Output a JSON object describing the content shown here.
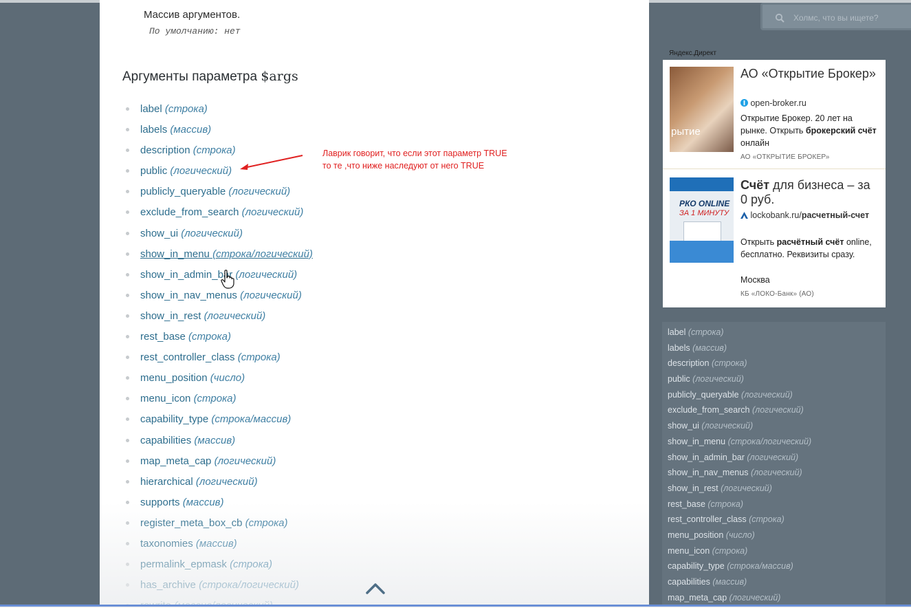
{
  "main": {
    "arg_description": "Массив аргументов.",
    "arg_default": "По умолчанию: нет",
    "section_title_prefix": "Аргументы параметра ",
    "section_title_code": "$args",
    "params": [
      {
        "name": "label",
        "type": "(строка)"
      },
      {
        "name": "labels",
        "type": "(массив)"
      },
      {
        "name": "description",
        "type": "(строка)"
      },
      {
        "name": "public",
        "type": "(логический)"
      },
      {
        "name": "publicly_queryable",
        "type": "(логический)"
      },
      {
        "name": "exclude_from_search",
        "type": "(логический)"
      },
      {
        "name": "show_ui",
        "type": "(логический)"
      },
      {
        "name": "show_in_menu",
        "type": "(строка/логический)"
      },
      {
        "name": "show_in_admin_bar",
        "type": "(логический)"
      },
      {
        "name": "show_in_nav_menus",
        "type": "(логический)"
      },
      {
        "name": "show_in_rest",
        "type": "(логический)"
      },
      {
        "name": "rest_base",
        "type": "(строка)"
      },
      {
        "name": "rest_controller_class",
        "type": "(строка)"
      },
      {
        "name": "menu_position",
        "type": "(число)"
      },
      {
        "name": "menu_icon",
        "type": "(строка)"
      },
      {
        "name": "capability_type",
        "type": "(строка/массив)"
      },
      {
        "name": "capabilities",
        "type": "(массив)"
      },
      {
        "name": "map_meta_cap",
        "type": "(логический)"
      },
      {
        "name": "hierarchical",
        "type": "(логический)"
      },
      {
        "name": "supports",
        "type": "(массив)"
      },
      {
        "name": "register_meta_box_cb",
        "type": "(строка)"
      },
      {
        "name": "taxonomies",
        "type": "(массив)"
      },
      {
        "name": "permalink_epmask",
        "type": "(строка)"
      },
      {
        "name": "has_archive",
        "type": "(строка/логический)"
      },
      {
        "name": "rewrite",
        "type": "(массив/логический)"
      }
    ],
    "annotation_line1": "Лаврик говорит, что если этот параметр TRUE",
    "annotation_line2": "то те ,что ниже наследуют от него TRUE"
  },
  "sidebar": {
    "search_placeholder": "Холмс, что вы ищете?",
    "ad_label": "Яндекс.Директ",
    "ads": [
      {
        "image_text": "рытие",
        "title": "АО «Открытие Брокер»",
        "domain": "open-broker.ru",
        "text_before": "Открытие Брокер. 20 лет на рынке. Открыть ",
        "text_bold": "брокерский счёт",
        "text_after": " онлайн",
        "org": "АО «ОТКРЫТИЕ БРОКЕР»"
      },
      {
        "image_line1": "РКО ONLINE",
        "image_line2": "ЗА 1 МИНУТУ",
        "title_bold": "Счёт",
        "title_rest": " для бизнеса – за 0 руб.",
        "domain_plain": "lockobank.ru/",
        "domain_bold": "расчетный-счет",
        "text_before": "Открыть ",
        "text_bold": "расчётный счёт",
        "text_after": " online, бесплатно. Реквизиты сразу.",
        "city": "Москва",
        "org": "КБ «ЛОКО-Банк» (АО)"
      }
    ],
    "params": [
      {
        "name": "label",
        "type": "(строка)"
      },
      {
        "name": "labels",
        "type": "(массив)"
      },
      {
        "name": "description",
        "type": "(строка)"
      },
      {
        "name": "public",
        "type": "(логический)"
      },
      {
        "name": "publicly_queryable",
        "type": "(логический)"
      },
      {
        "name": "exclude_from_search",
        "type": "(логический)"
      },
      {
        "name": "show_ui",
        "type": "(логический)"
      },
      {
        "name": "show_in_menu",
        "type": "(строка/логический)"
      },
      {
        "name": "show_in_admin_bar",
        "type": "(логический)"
      },
      {
        "name": "show_in_nav_menus",
        "type": "(логический)"
      },
      {
        "name": "show_in_rest",
        "type": "(логический)"
      },
      {
        "name": "rest_base",
        "type": "(строка)"
      },
      {
        "name": "rest_controller_class",
        "type": "(строка)"
      },
      {
        "name": "menu_position",
        "type": "(число)"
      },
      {
        "name": "menu_icon",
        "type": "(строка)"
      },
      {
        "name": "capability_type",
        "type": "(строка/массив)"
      },
      {
        "name": "capabilities",
        "type": "(массив)"
      },
      {
        "name": "map_meta_cap",
        "type": "(логический)"
      }
    ]
  },
  "colors": {
    "link": "#2e6e8e",
    "annotation": "#e02020",
    "sidebar_bg": "#5d6b76"
  }
}
